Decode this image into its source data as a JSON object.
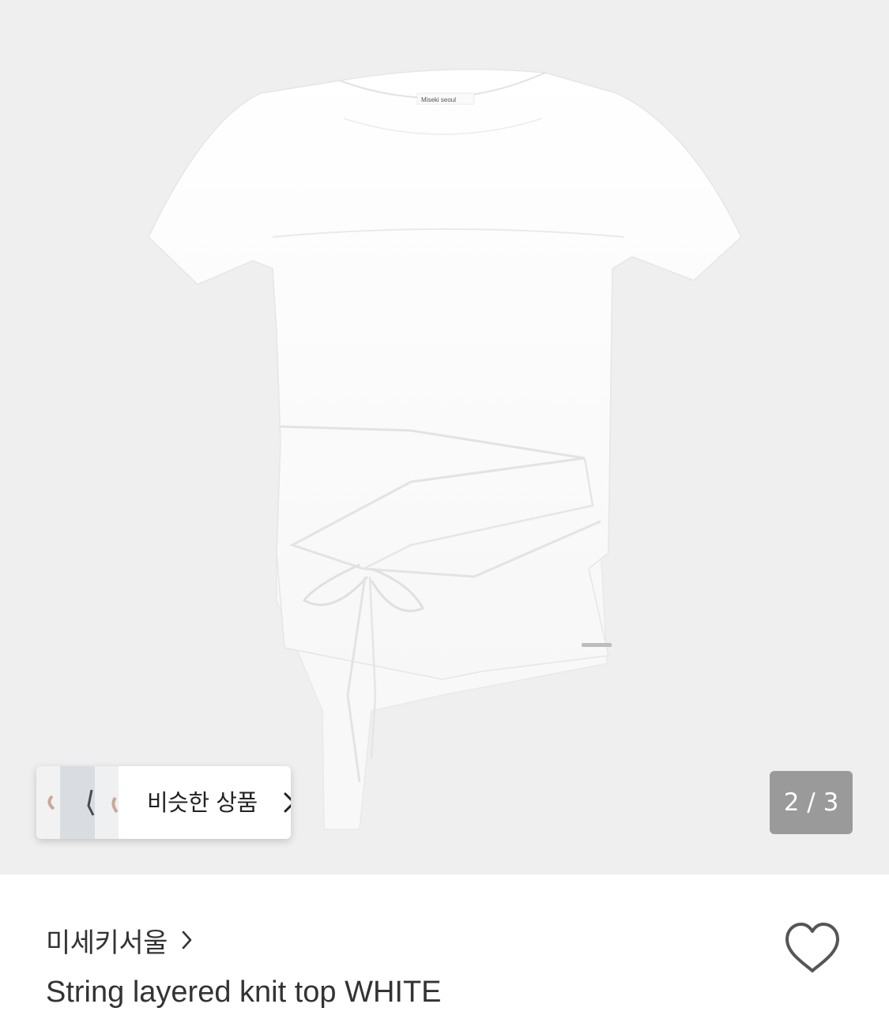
{
  "gallery": {
    "neck_label_text": "Miseki seoul",
    "counter_current": "2",
    "counter_separator": "/",
    "counter_total": "3",
    "counter_text": "2 / 3",
    "background_color": "#efefef"
  },
  "similar_products": {
    "label": "비슷한 상품",
    "thumbnail_icon": "model-photo-thumbnail",
    "chevron_icon": "chevron-right-icon"
  },
  "product": {
    "brand_name": "미세키서울",
    "brand_chevron_icon": "chevron-right-icon",
    "title": "String layered knit top WHITE",
    "wishlist_icon": "heart-outline-icon"
  },
  "colors": {
    "text_primary": "#333333",
    "counter_bg": "#8a8a8a",
    "card_bg": "#ffffff",
    "heart_stroke": "#555555"
  }
}
